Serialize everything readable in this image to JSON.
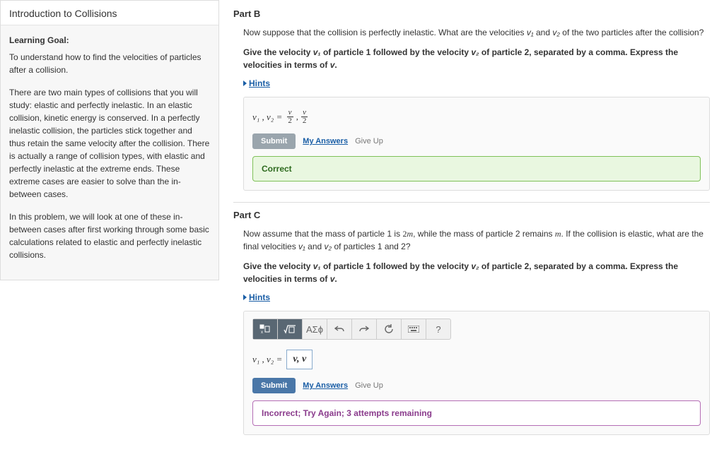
{
  "sidebar": {
    "title": "Introduction to Collisions",
    "learning_goal_label": "Learning Goal:",
    "learning_goal_text": "To understand how to find the velocities of particles after a collision.",
    "para1": "There are two main types of collisions that you will study: elastic and perfectly inelastic. In an elastic collision, kinetic energy is conserved. In a perfectly inelastic collision, the particles stick together and thus retain the same velocity after the collision. There is actually a range of collision types, with elastic and perfectly inelastic at the extreme ends. These extreme cases are easier to solve than the in-between cases.",
    "para2": "In this problem, we will look at one of these in-between cases after first working through some basic calculations related to elastic and perfectly inelastic collisions."
  },
  "partB": {
    "heading": "Part B",
    "q1a": "Now suppose that the collision is perfectly inelastic. What are the velocities ",
    "q1b": " and ",
    "q1c": " of the two particles after the collision?",
    "q2a": "Give the velocity ",
    "q2b": " of particle 1 followed by the velocity ",
    "q2c": " of particle 2, separated by a comma. Express the velocities in terms of ",
    "q2d": ".",
    "hints": "Hints",
    "var_label": "v₁ , v₂  =",
    "submit": "Submit",
    "my_answers": "My Answers",
    "give_up": "Give Up",
    "feedback": "Correct"
  },
  "partC": {
    "heading": "Part C",
    "q1a": "Now assume that the mass of particle 1 is ",
    "q1b": ", while the mass of particle 2 remains ",
    "q1c": ". If the collision is elastic, what are the final velocities ",
    "q1d": " and ",
    "q1e": " of particles 1 and 2?",
    "q2a": "Give the velocity ",
    "q2b": " of particle 1 followed by the velocity ",
    "q2c": " of particle 2, separated by a comma. Express the velocities in terms of ",
    "q2d": ".",
    "hints": "Hints",
    "var_label": "v₁ , v₂  =",
    "input_value": "v, v",
    "submit": "Submit",
    "my_answers": "My Answers",
    "give_up": "Give Up",
    "feedback": "Incorrect; Try Again; 3 attempts remaining",
    "tool_greek": "ΑΣϕ",
    "tool_q": "?"
  },
  "sym": {
    "v1": "v₁",
    "v2": "v₂",
    "v": "v",
    "two_m": "2m",
    "m": "m"
  }
}
